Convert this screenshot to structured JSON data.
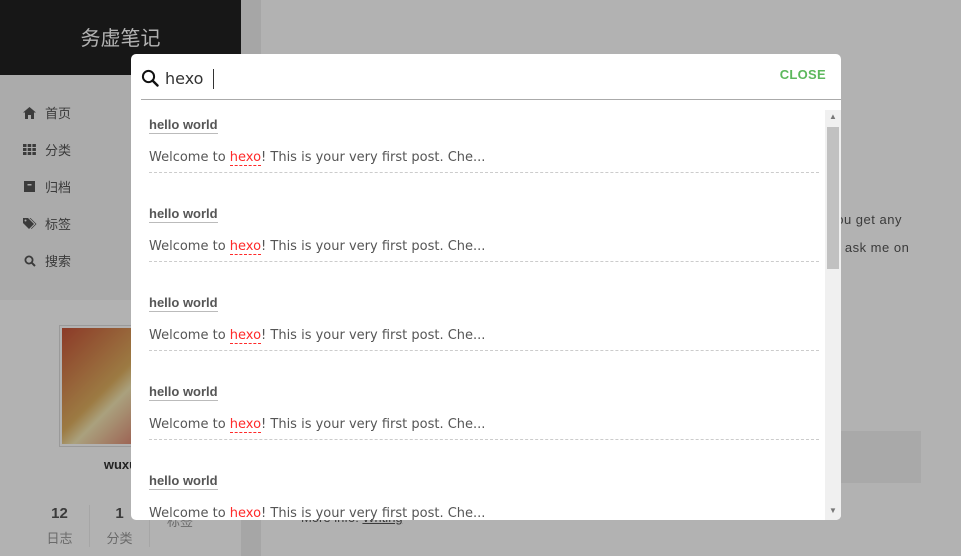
{
  "site": {
    "brand": "务虚笔记"
  },
  "sidebar": {
    "menu": [
      {
        "label": "首页",
        "icon": "home-icon"
      },
      {
        "label": "分类",
        "icon": "th-icon"
      },
      {
        "label": "归档",
        "icon": "archive-icon"
      },
      {
        "label": "标签",
        "icon": "tags-icon"
      },
      {
        "label": "搜索",
        "icon": "search-icon"
      }
    ],
    "author": "wuxu",
    "stats": [
      {
        "value": "12",
        "label": "日志"
      },
      {
        "value": "1",
        "label": "分类"
      },
      {
        "value": "",
        "label": "标签"
      }
    ]
  },
  "main": {
    "fragment_1": "f you get any",
    "fragment_2": "n ask me on",
    "more_prefix": "More info:",
    "more_link": "Writing"
  },
  "search": {
    "query": "hexo",
    "close_label": "CLOSE",
    "results": [
      {
        "title": "hello world",
        "before": "Welcome to ",
        "keyword": "hexo",
        "after": "! This is your very first post. Che..."
      },
      {
        "title": "hello world",
        "before": "Welcome to ",
        "keyword": "hexo",
        "after": "! This is your very first post. Che..."
      },
      {
        "title": "hello world",
        "before": "Welcome to ",
        "keyword": "hexo",
        "after": "! This is your very first post. Che..."
      },
      {
        "title": "hello world",
        "before": "Welcome to ",
        "keyword": "hexo",
        "after": "! This is your very first post. Che..."
      },
      {
        "title": "hello world",
        "before": "Welcome to ",
        "keyword": "hexo",
        "after": "! This is your very first post. Che..."
      }
    ]
  },
  "colors": {
    "accent": "#5cb85c",
    "keyword": "#ff2a2a",
    "brand_bg": "#222222"
  }
}
